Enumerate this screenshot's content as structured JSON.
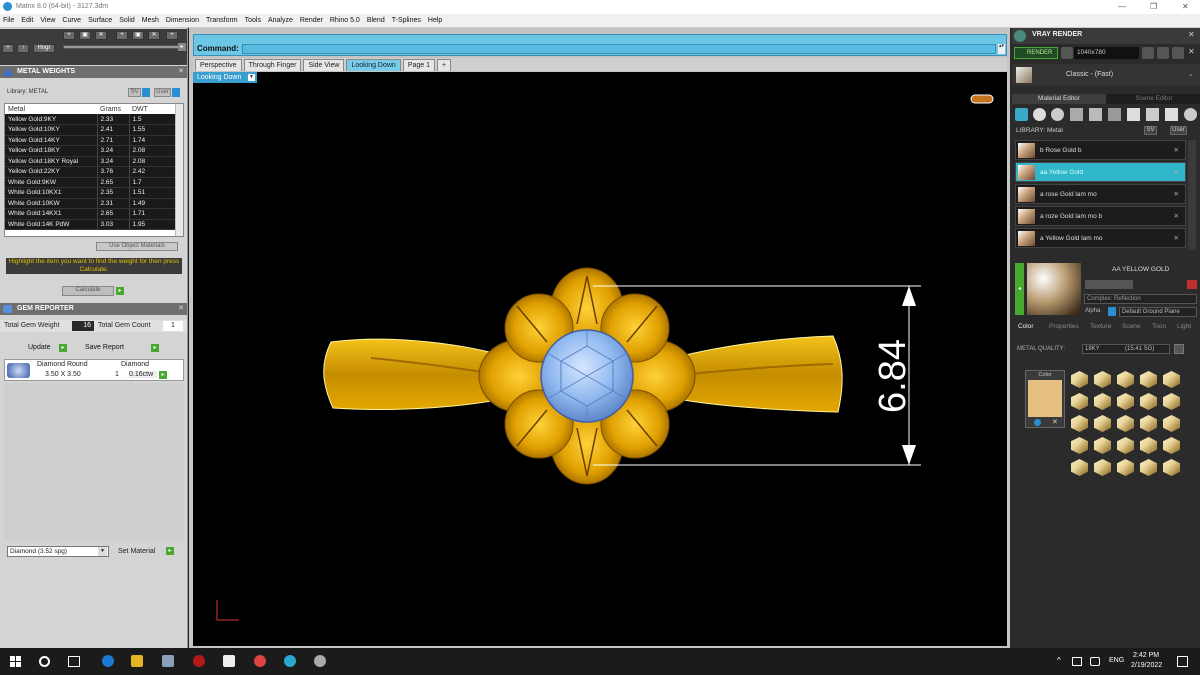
{
  "window": {
    "title": "Matrix 8.0 (64-bit) - 3127.3dm"
  },
  "menu": [
    "File",
    "Edit",
    "View",
    "Curve",
    "Surface",
    "Solid",
    "Mesh",
    "Dimension",
    "Transform",
    "Tools",
    "Analyze",
    "Render",
    "Rhino 5.0",
    "Blend",
    "T-Splines",
    "Help"
  ],
  "toolbar": {
    "hinge_label": "Hngr"
  },
  "metal_weights": {
    "title": "METAL WEIGHTS",
    "library_label": "Library: METAL",
    "sv": "SV",
    "user": "User",
    "columns": [
      "Metal",
      "Grams",
      "DWT"
    ],
    "rows": [
      [
        "Yellow Gold:9KY",
        "2.33",
        "1.5"
      ],
      [
        "Yellow Gold:10KY",
        "2.41",
        "1.55"
      ],
      [
        "Yellow Gold:14KY",
        "2.71",
        "1.74"
      ],
      [
        "Yellow Gold:18KY",
        "3.24",
        "2.08"
      ],
      [
        "Yellow Gold:18KY Royal",
        "3.24",
        "2.08"
      ],
      [
        "Yellow Gold:22KY",
        "3.76",
        "2.42"
      ],
      [
        "White Gold:9KW",
        "2.65",
        "1.7"
      ],
      [
        "White Gold:10KX1",
        "2.35",
        "1.51"
      ],
      [
        "White Gold:10KW",
        "2.31",
        "1.49"
      ],
      [
        "White Gold:14KX1",
        "2.65",
        "1.71"
      ],
      [
        "White Gold:14K PdW",
        "3.03",
        "1.95"
      ]
    ],
    "use_object_materials": "Use Object Materials",
    "hint": "Highlight the item you want to find the weight for then press Calculate.",
    "calculate": "Calculate"
  },
  "gem_reporter": {
    "title": "GEM REPORTER",
    "total_gem_weight_label": "Total Gem Weight",
    "total_gem_weight": "16",
    "total_gem_count_label": "Total Gem Count",
    "total_gem_count": "1",
    "update": "Update",
    "save_report": "Save Report",
    "gem_name": "Diamond Round",
    "gem_size": "3.50 X 3.50",
    "gem_material": "Diamond",
    "gem_qty": "1",
    "gem_ctw": "0.16ctw",
    "material_select": "Diamond    (3.52 spg)",
    "set_material": "Set Material"
  },
  "command": {
    "label": "Command:"
  },
  "viewport_tabs": [
    "Perspective",
    "Through Finger",
    "Side View",
    "Looking Down",
    "Page 1"
  ],
  "active_tab": "Looking Down",
  "viewport_label": "Looking Down",
  "dimension_value": "6.84",
  "vray": {
    "title": "VRAY RENDER",
    "render_btn": "RENDER",
    "resolution": "1040x780",
    "style": "Classic - (Fast)",
    "material_editor": "Material Editor",
    "scene_editor": "Scene Editor",
    "library_label": "LIBRARY: Metal",
    "materials": [
      "b Rose Gold b",
      "aa Yellow Gold",
      "a rose Gold lam mo",
      "a roze Gold lam mo b",
      "a Yellow Gold lam mo"
    ],
    "selected_material": "AA YELLOW GOLD",
    "complex": "Complex: Reflection",
    "alpha": "Alpha",
    "ground": "Default Ground Plane",
    "tabs": [
      "Color",
      "Properties",
      "Texture",
      "Scene",
      "Toon",
      "Light"
    ],
    "metal_quality_label": "METAL QUALITY:",
    "metal_quality": "18KY",
    "metal_quality_val": "(15.41 SG)",
    "color_label": "Color"
  },
  "taskbar": {
    "lang": "ENG",
    "time": "2:42 PM",
    "date": "2/19/2022"
  },
  "colors": {
    "accent": "#6cc6e6",
    "gold": "#e2a800",
    "gem": "#8fb8ef"
  }
}
